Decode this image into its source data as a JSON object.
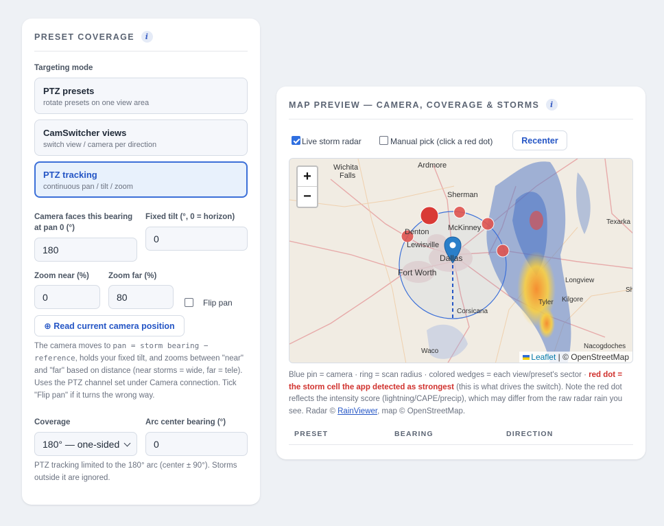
{
  "left": {
    "title": "PRESET COVERAGE",
    "targeting_label": "Targeting mode",
    "modes": [
      {
        "title": "PTZ presets",
        "subtitle": "rotate presets on one view area",
        "active": false
      },
      {
        "title": "CamSwitcher views",
        "subtitle": "switch view / camera per direction",
        "active": false
      },
      {
        "title": "PTZ tracking",
        "subtitle": "continuous pan / tilt / zoom",
        "active": true
      }
    ],
    "bearing_label": "Camera faces this bearing at pan 0 (°)",
    "bearing_value": "180",
    "tilt_label": "Fixed tilt (°, 0 = horizon)",
    "tilt_value": "0",
    "zoom_near_label": "Zoom near (%)",
    "zoom_near_value": "0",
    "zoom_far_label": "Zoom far (%)",
    "zoom_far_value": "80",
    "flip_pan_label": "Flip pan",
    "flip_pan_checked": false,
    "read_position_button": "⊕ Read current camera position",
    "help": {
      "p1": "The camera moves to ",
      "code1": "pan = storm bearing − reference",
      "p2": ", holds your fixed tilt, and zooms between \"near\" and \"far\" based on distance (near storms = wide, far = tele). Uses the PTZ channel set under Camera connection. Tick \"Flip pan\" if it turns the wrong way."
    },
    "coverage_label": "Coverage",
    "coverage_value": "180° — one-sided",
    "arc_label": "Arc center bearing (°)",
    "arc_value": "0",
    "coverage_note": "PTZ tracking limited to the 180° arc (center ± 90°). Storms outside it are ignored."
  },
  "right": {
    "title": "MAP PREVIEW — CAMERA, COVERAGE & STORMS",
    "live_radar_label": "Live storm radar",
    "live_radar_checked": true,
    "manual_pick_label": "Manual pick (click a red dot)",
    "manual_pick_checked": false,
    "recenter_button": "Recenter",
    "zoom_in": "+",
    "zoom_out": "−",
    "attribution_leaflet": "Leaflet",
    "attribution_rest": "| © OpenStreetMap",
    "map_labels": {
      "wichita_falls_1": "Wichita",
      "wichita_falls_2": "Falls",
      "ardmore": "Ardmore",
      "sherman": "Sherman",
      "denton": "Denton",
      "mckinney": "McKinney",
      "lewisville": "Lewisville",
      "dallas": "Dallas",
      "fort_worth": "Fort Worth",
      "texarkana": "Texarka",
      "longview": "Longview",
      "kilgore": "Kilgore",
      "tyler": "Tyler",
      "corsicana": "Corsicana",
      "nacogdoches": "Nacogdoches",
      "waco": "Waco",
      "shreveport": "Sh"
    },
    "caption": {
      "p1": "Blue pin = camera · ring = scan radius · colored wedges = each view/preset's sector · ",
      "red": "red dot = the storm cell the app detected as strongest",
      "p2": " (this is what drives the switch). Note the red dot reflects the intensity score (lightning/CAPE/precip), which may differ from the raw radar rain you see. Radar © ",
      "link": "RainViewer",
      "p3": ", map © OpenStreetMap."
    },
    "table_headers": [
      "PRESET",
      "BEARING",
      "DIRECTION"
    ]
  },
  "colors": {
    "accent": "#2455c5",
    "storm_dot": "#d93a36",
    "camera_pin": "#2b7fc9"
  }
}
